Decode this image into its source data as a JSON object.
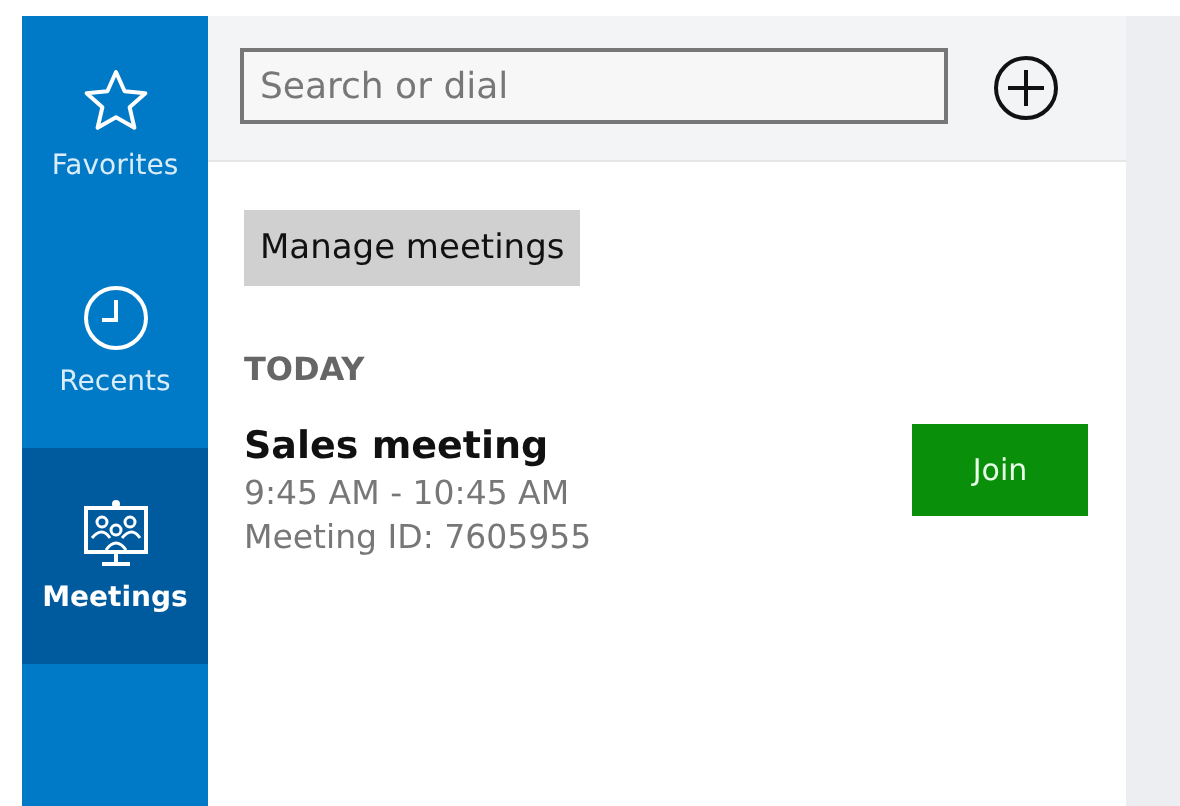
{
  "sidebar": {
    "items": [
      {
        "kind": "star",
        "label": "Favorites",
        "selected": false
      },
      {
        "kind": "clock",
        "label": "Recents",
        "selected": false
      },
      {
        "kind": "meeting",
        "label": "Meetings",
        "selected": true
      }
    ]
  },
  "search": {
    "placeholder": "Search or dial"
  },
  "manage_button": "Manage meetings",
  "section_heading": "TODAY",
  "meetings": [
    {
      "title": "Sales meeting",
      "time": "9:45 AM - 10:45 AM",
      "meeting_id": "Meeting ID: 7605955",
      "action": "Join"
    }
  ]
}
